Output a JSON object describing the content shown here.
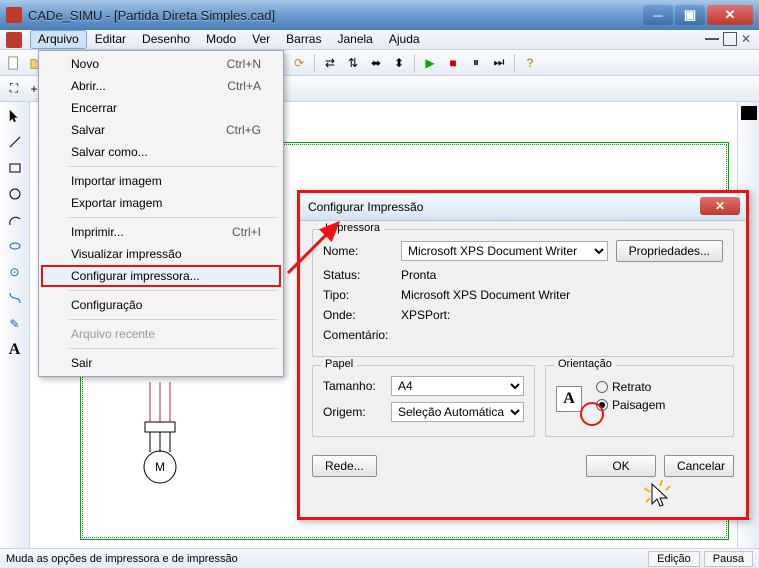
{
  "window": {
    "title": "CADe_SIMU - [Partida Direta Simples.cad]"
  },
  "menu": {
    "items": [
      "Arquivo",
      "Editar",
      "Desenho",
      "Modo",
      "Ver",
      "Barras",
      "Janela",
      "Ajuda"
    ],
    "active_index": 0
  },
  "dropdown": {
    "items": [
      {
        "label": "Novo",
        "shortcut": "Ctrl+N"
      },
      {
        "label": "Abrir...",
        "shortcut": "Ctrl+A"
      },
      {
        "label": "Encerrar",
        "shortcut": ""
      },
      {
        "label": "Salvar",
        "shortcut": "Ctrl+G"
      },
      {
        "label": "Salvar como...",
        "shortcut": ""
      },
      {
        "sep": true
      },
      {
        "label": "Importar imagem",
        "shortcut": ""
      },
      {
        "label": "Exportar imagem",
        "shortcut": ""
      },
      {
        "sep": true
      },
      {
        "label": "Imprimir...",
        "shortcut": "Ctrl+I"
      },
      {
        "label": "Visualizar impressão",
        "shortcut": ""
      },
      {
        "label": "Configurar impressora...",
        "shortcut": "",
        "highlighted": true
      },
      {
        "sep": true
      },
      {
        "label": "Configuração",
        "shortcut": ""
      },
      {
        "sep": true
      },
      {
        "label": "Arquivo recente",
        "shortcut": "",
        "disabled": true
      },
      {
        "sep": true
      },
      {
        "label": "Sair",
        "shortcut": ""
      }
    ]
  },
  "dialog": {
    "title": "Configurar Impressão",
    "printer_group": "Impressora",
    "name_label": "Nome:",
    "name_value": "Microsoft XPS Document Writer",
    "properties_btn": "Propriedades...",
    "status_label": "Status:",
    "status_value": "Pronta",
    "type_label": "Tipo:",
    "type_value": "Microsoft XPS Document Writer",
    "where_label": "Onde:",
    "where_value": "XPSPort:",
    "comment_label": "Comentário:",
    "paper_group": "Papel",
    "size_label": "Tamanho:",
    "size_value": "A4",
    "source_label": "Origem:",
    "source_value": "Seleção Automática",
    "orient_group": "Orientação",
    "portrait": "Retrato",
    "landscape": "Paisagem",
    "network_btn": "Rede...",
    "ok_btn": "OK",
    "cancel_btn": "Cancelar"
  },
  "status": {
    "text": "Muda as opções de impressora e de impressão",
    "cell1": "Edição",
    "cell2": "Pausa"
  }
}
